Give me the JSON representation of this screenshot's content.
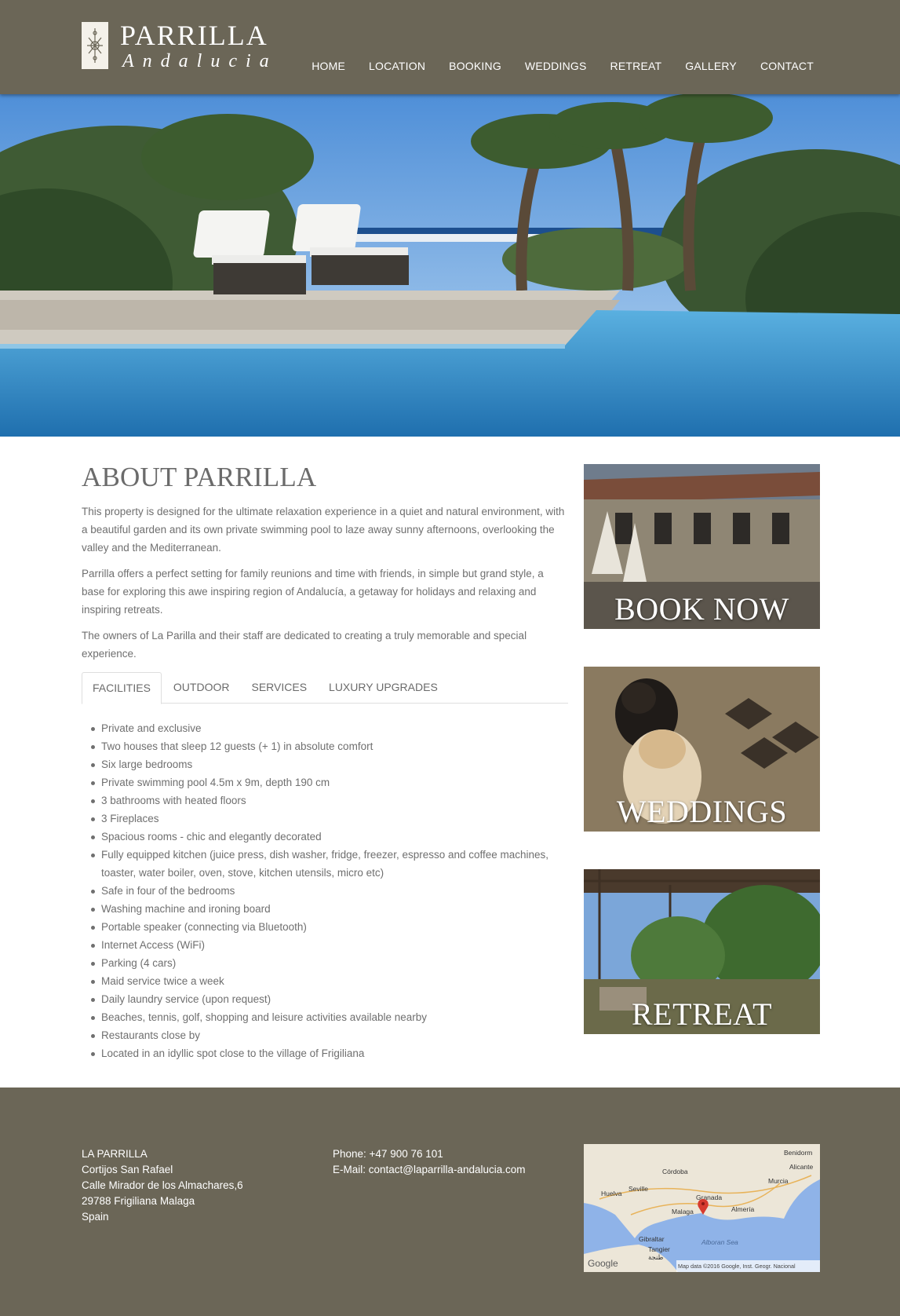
{
  "brand": {
    "name": "PARRILLA",
    "tagline": "Andalucia"
  },
  "nav": {
    "items": [
      {
        "label": "HOME"
      },
      {
        "label": "LOCATION"
      },
      {
        "label": "BOOKING"
      },
      {
        "label": "WEDDINGS"
      },
      {
        "label": "RETREAT"
      },
      {
        "label": "GALLERY"
      },
      {
        "label": "CONTACT"
      }
    ]
  },
  "about": {
    "title": "ABOUT PARRILLA",
    "paragraphs": [
      "This property is designed for the ultimate relaxation experience in a quiet and natural environment, with a beautiful garden and its own private swimming pool to laze away sunny afternoons, overlooking the valley and the Mediterranean.",
      "Parrilla offers a perfect setting for family reunions and time with friends, in simple but grand style, a base for exploring this awe inspiring region of Andalucía, a getaway for holidays and relaxing and inspiring retreats.",
      "The owners of La Parilla and their staff are dedicated to creating a truly memorable and special experience."
    ]
  },
  "tabs": [
    {
      "label": "FACILITIES",
      "active": true
    },
    {
      "label": "OUTDOOR",
      "active": false
    },
    {
      "label": "SERVICES",
      "active": false
    },
    {
      "label": "LUXURY UPGRADES",
      "active": false
    }
  ],
  "facilities": [
    "Private and exclusive",
    "Two houses that sleep 12 guests (+ 1) in absolute comfort",
    "Six large bedrooms",
    "Private swimming pool 4.5m x 9m, depth 190 cm",
    "3 bathrooms with heated floors",
    "3 Fireplaces",
    "Spacious rooms - chic and elegantly decorated",
    "Fully equipped kitchen (juice press, dish washer, fridge, freezer, espresso and coffee machines, toaster, water boiler, oven, stove, kitchen utensils, micro etc)",
    "Safe in four of the bedrooms",
    "Washing machine and ironing board",
    "Portable speaker (connecting via Bluetooth)",
    "Internet Access (WiFi)",
    "Parking (4 cars)",
    "Maid service twice a week",
    "Daily laundry service (upon request)",
    "Beaches, tennis, golf, shopping and leisure activities available nearby",
    "Restaurants close by",
    "Located in an idyllic spot close to the village of Frigiliana"
  ],
  "promos": {
    "book": "BOOK NOW",
    "weddings": "WEDDINGS",
    "retreat": "RETREAT"
  },
  "footer": {
    "address": [
      "LA PARRILLA",
      "Cortijos San Rafael",
      "Calle Mirador de los Almachares,6",
      "29788 Frigiliana Malaga",
      "Spain"
    ],
    "phone": "Phone: +47 900 76 101",
    "email": "E-Mail: contact@laparrilla-andalucia.com"
  },
  "map": {
    "places": [
      "Benidorm",
      "Alicante",
      "Córdoba",
      "Murcia",
      "Seville",
      "Huelva",
      "Granada",
      "Almería",
      "Malaga",
      "Gibraltar",
      "Tangier",
      "طنجة",
      "Alboran Sea"
    ],
    "logo": "Google",
    "attribution": "Map data ©2016 Google, Inst. Geogr. Nacional"
  },
  "colors": {
    "header": "#6b6657",
    "footer": "#6b6657",
    "text": "#6b6b6b"
  }
}
